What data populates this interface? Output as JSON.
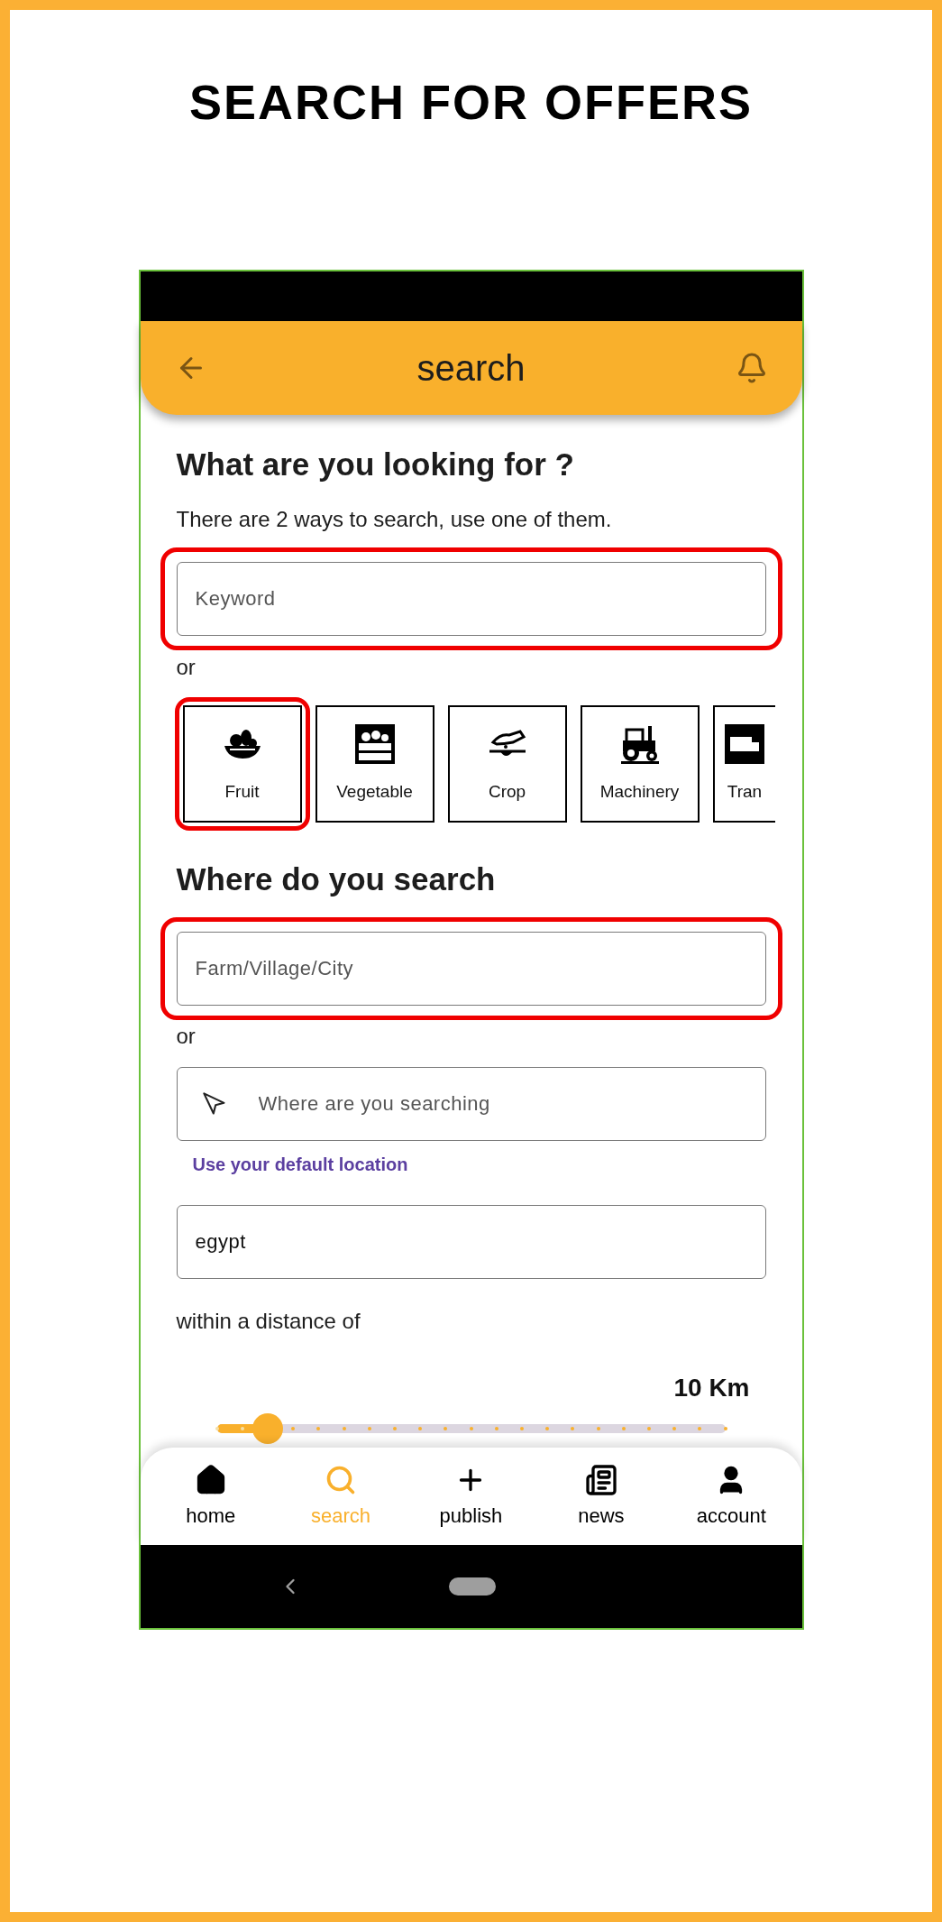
{
  "page_title": "SEARCH FOR OFFERS",
  "app_bar": {
    "title": "search"
  },
  "section_1": {
    "heading": "What are you looking for ?",
    "subtitle": "There are 2 ways to search, use one of them.",
    "keyword_field": {
      "placeholder": "Keyword",
      "highlighted": true
    },
    "or": "or",
    "categories": [
      {
        "label": "Fruit",
        "highlighted": true
      },
      {
        "label": "Vegetable",
        "highlighted": false
      },
      {
        "label": "Crop",
        "highlighted": false
      },
      {
        "label": "Machinery",
        "highlighted": false
      },
      {
        "label": "Tran",
        "highlighted": false
      }
    ]
  },
  "section_2": {
    "heading": "Where do you search",
    "place_field": {
      "placeholder": "Farm/Village/City",
      "highlighted": true
    },
    "or": "or",
    "location_field": {
      "placeholder": "Where are you searching"
    },
    "default_location_link": "Use your default location",
    "country_field": {
      "value": "egypt"
    },
    "distance_label": "within a distance of",
    "distance_value": "10 Km",
    "distance_slider": {
      "level": 0.1
    }
  },
  "bottom_nav": [
    {
      "label": "home",
      "selected": false
    },
    {
      "label": "search",
      "selected": true
    },
    {
      "label": "publish",
      "selected": false
    },
    {
      "label": "news",
      "selected": false
    },
    {
      "label": "account",
      "selected": false
    }
  ]
}
